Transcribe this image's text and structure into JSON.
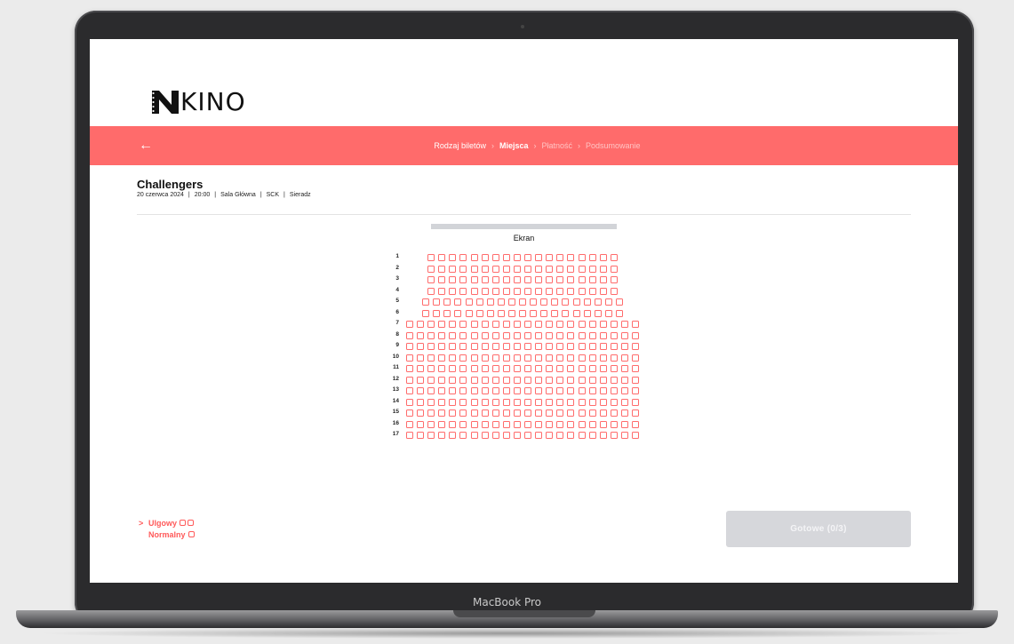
{
  "device": {
    "brand_label": "MacBook Pro"
  },
  "logo": {
    "text": "KINO"
  },
  "nav": {
    "steps": [
      {
        "label": "Rodzaj biletów",
        "state": "done"
      },
      {
        "label": "Miejsca",
        "state": "active"
      },
      {
        "label": "Płatność",
        "state": "pending"
      },
      {
        "label": "Podsumowanie",
        "state": "pending"
      }
    ],
    "separator": "›",
    "back_icon": "arrow-left-icon"
  },
  "movie": {
    "title": "Challengers",
    "meta": [
      "20 czerwca 2024",
      "|",
      "20:00",
      "|",
      "Sala Główna",
      "|",
      "SCK",
      "|",
      "Sieradz"
    ]
  },
  "screen_label": "Ekran",
  "seating": {
    "rows": [
      {
        "label": "1",
        "seats": 18
      },
      {
        "label": "2",
        "seats": 18
      },
      {
        "label": "3",
        "seats": 18
      },
      {
        "label": "4",
        "seats": 18
      },
      {
        "label": "5",
        "seats": 19
      },
      {
        "label": "6",
        "seats": 19
      },
      {
        "label": "7",
        "seats": 22
      },
      {
        "label": "8",
        "seats": 22
      },
      {
        "label": "9",
        "seats": 22
      },
      {
        "label": "10",
        "seats": 22
      },
      {
        "label": "11",
        "seats": 22
      },
      {
        "label": "12",
        "seats": 22
      },
      {
        "label": "13",
        "seats": 22
      },
      {
        "label": "14",
        "seats": 22
      },
      {
        "label": "15",
        "seats": 22
      },
      {
        "label": "16",
        "seats": 22
      },
      {
        "label": "17",
        "seats": 22
      }
    ]
  },
  "legend": {
    "marker": ">",
    "items": [
      {
        "label": "Ulgowy",
        "icon_count": 2
      },
      {
        "label": "Normalny",
        "icon_count": 1
      }
    ]
  },
  "done_button": {
    "label": "Gotowe (0/3)"
  },
  "colors": {
    "accent": "#ff6b6b",
    "disabled_button": "#d6d7db"
  }
}
